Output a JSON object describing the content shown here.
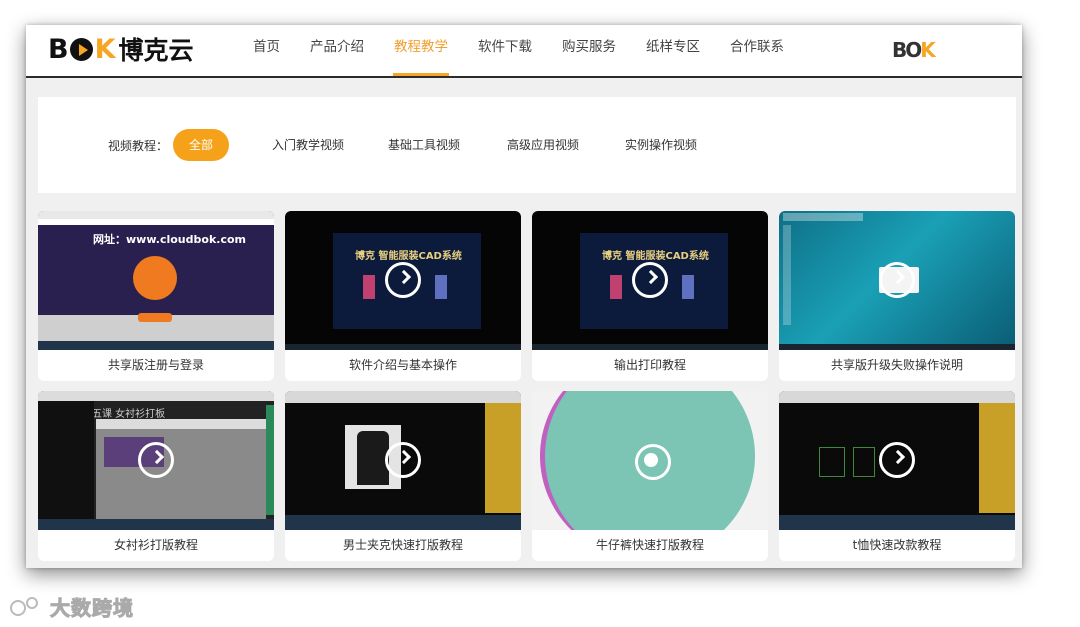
{
  "brand": {
    "logo_latin": [
      "B",
      "K"
    ],
    "logo_cn": "博克云",
    "right_logo": [
      "BO",
      "K"
    ]
  },
  "nav": {
    "items": [
      "首页",
      "产品介绍",
      "教程教学",
      "软件下载",
      "购买服务",
      "纸样专区",
      "合作联系"
    ],
    "active": "教程教学"
  },
  "filter": {
    "label": "视频教程：",
    "options": [
      "全部",
      "入门教学视频",
      "基础工具视频",
      "高级应用视频",
      "实例操作视频"
    ],
    "selected": "全部"
  },
  "videos": [
    {
      "title": "共享版注册与登录",
      "thumb_text": "网址：www.cloudbok.com",
      "icon": "play-icon"
    },
    {
      "title": "软件介绍与基本操作",
      "thumb_text": "博克 智能服装CAD系统",
      "icon": "play-icon"
    },
    {
      "title": "输出打印教程",
      "thumb_text": "博克 智能服装CAD系统",
      "icon": "play-icon"
    },
    {
      "title": "共享版升级失败操作说明",
      "thumb_text": "",
      "icon": "play-icon"
    },
    {
      "title": "女衬衫打版教程",
      "thumb_text": "第五课 女衬衫打板",
      "icon": "play-icon"
    },
    {
      "title": "男士夹克快速打版教程",
      "thumb_text": "",
      "icon": "play-icon"
    },
    {
      "title": "牛仔裤快速打版教程",
      "thumb_text": "",
      "icon": "loading-icon"
    },
    {
      "title": "t恤快速改款教程",
      "thumb_text": "",
      "icon": "play-icon"
    }
  ],
  "watermark": "大数跨境",
  "colors": {
    "accent": "#f5a623",
    "nav_active": "#f0a030"
  }
}
